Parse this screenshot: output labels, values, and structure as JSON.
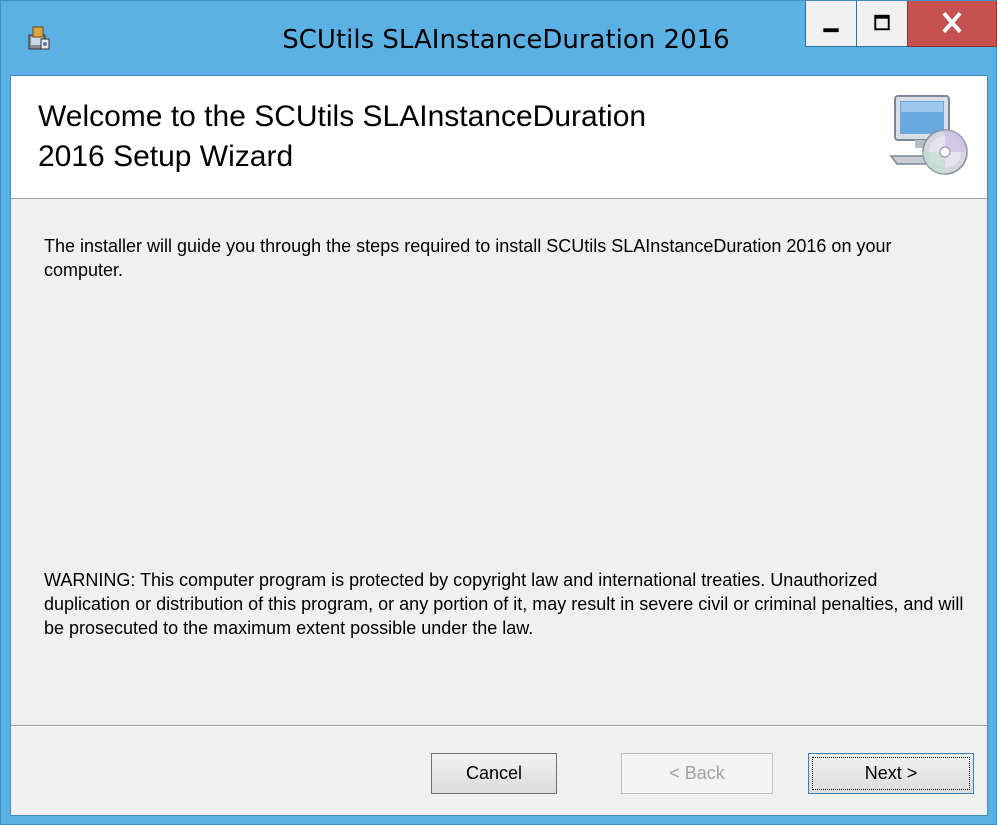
{
  "window": {
    "title": "SCUtils SLAInstanceDuration 2016",
    "icon": "installer-icon",
    "controls": {
      "minimize": "minimize-icon",
      "maximize": "maximize-icon",
      "close": "close-icon"
    }
  },
  "banner": {
    "title": "Welcome to the SCUtils SLAInstanceDuration\n2016 Setup Wizard",
    "icon": "computer-cd-icon"
  },
  "content": {
    "intro": "The installer will guide you through the steps required to install SCUtils SLAInstanceDuration 2016 on your computer.",
    "warning": "WARNING: This computer program is protected by copyright law and international treaties. Unauthorized duplication or distribution of this program, or any portion of it, may result in severe civil or criminal penalties, and will be prosecuted to the maximum extent possible under the law."
  },
  "buttons": {
    "cancel": "Cancel",
    "back": "< Back",
    "next": "Next >",
    "back_enabled": false
  },
  "colors": {
    "titlebar": "#5bb1e4",
    "close_button": "#c75050",
    "client": "#f0f0f0"
  }
}
